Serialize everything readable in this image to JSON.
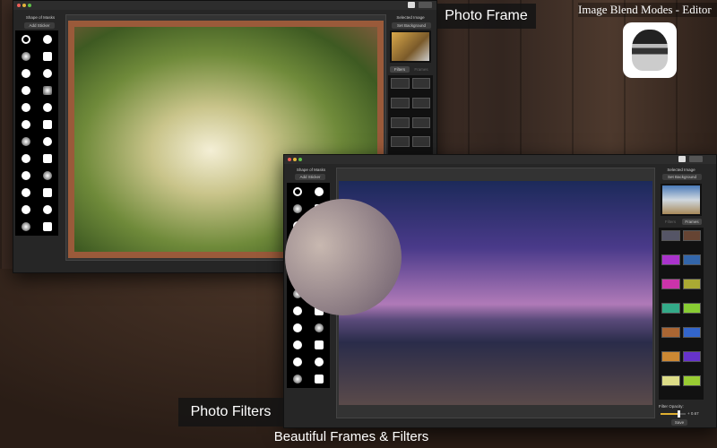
{
  "app_title": "Image Blend Modes - Editor",
  "captions": {
    "photo_frame": "Photo Frame",
    "photo_filters": "Photo Filters",
    "footer": "Beautiful Frames & Filters"
  },
  "window1": {
    "masks_title": "Shape of Masks",
    "add_sticker": "Add Sticker",
    "selected_image": "Selected Image",
    "set_background": "Set Background",
    "tab_filters": "Filters",
    "tab_frames": "Frames",
    "active_tab": "Filters"
  },
  "window2": {
    "masks_title": "Shape of Masks",
    "add_sticker": "Add Sticker",
    "selected_image": "Selected Image",
    "set_background": "Set Background",
    "tab_filters": "Filters",
    "tab_frames": "Frames",
    "active_tab": "Frames",
    "filter_opacity_label": "Filter Opacity:",
    "filter_opacity_value": "+ 0.67",
    "filter_opacity": 0.67,
    "save": "Save"
  },
  "mask_icons": [
    "none-icon",
    "flower-icon",
    "starburst-icon",
    "rounded-rect-icon",
    "speech-bubble-icon",
    "soft-circle-icon",
    "arrow-icon",
    "badge-icon",
    "square-icon",
    "film-icon",
    "sun-icon",
    "gear-icon",
    "cloud-icon",
    "circle-blur-icon",
    "leaf-icon",
    "ring-icon",
    "splash-icon",
    "ring-icon",
    "flower-icon",
    "blur-dot-icon",
    "flower-icon",
    "star-icon",
    "feather-icon",
    "circle-icon"
  ],
  "colors": {
    "window": "#262626",
    "panel": "#000000",
    "accent_tab": "#3c3c3c"
  }
}
